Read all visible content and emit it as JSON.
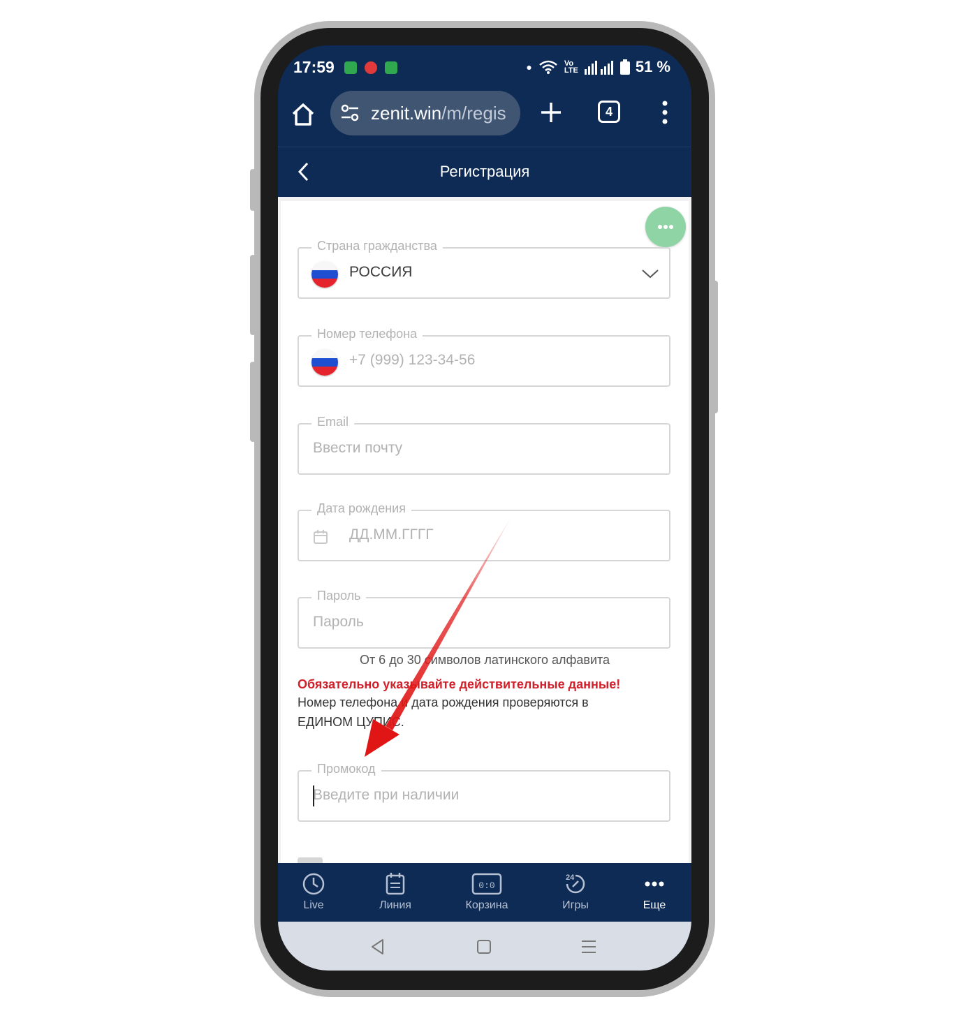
{
  "status_bar": {
    "time": "17:59",
    "battery": "51 %"
  },
  "browser": {
    "url_main": "zenit.win",
    "url_path": "/m/regis",
    "tab_count": "4"
  },
  "header": {
    "title": "Регистрация"
  },
  "form": {
    "citizenship": {
      "label": "Страна гражданства",
      "value": "РОССИЯ"
    },
    "phone": {
      "label": "Номер телефона",
      "placeholder": "+7 (999) 123-34-56"
    },
    "email": {
      "label": "Email",
      "placeholder": "Ввести почту"
    },
    "birthdate": {
      "label": "Дата рождения",
      "placeholder": "ДД.ММ.ГГГГ"
    },
    "password": {
      "label": "Пароль",
      "placeholder": "Пароль",
      "hint": "От 6 до 30 символов латинского алфавита"
    },
    "warning": "Обязательно указывайте действительные данные!",
    "info_line1": "Номер телефона и дата рождения проверяются в",
    "info_line2": "ЕДИНОМ ЦУПИС.",
    "promo": {
      "label": "Промокод",
      "placeholder": "Введите при наличии"
    }
  },
  "tab_bar": {
    "items": [
      {
        "label": "Live",
        "icon": "clock-icon"
      },
      {
        "label": "Линия",
        "icon": "calendar-icon"
      },
      {
        "label": "Корзина",
        "icon": "scoreboard-icon",
        "badge": "0:0"
      },
      {
        "label": "Игры",
        "icon": "games-24-icon",
        "badge": "24"
      },
      {
        "label": "Еще",
        "icon": "more-icon",
        "active": true
      }
    ]
  },
  "colors": {
    "header_bg": "#0d2b55",
    "accent_red": "#d0202a",
    "chat_green": "#8fd4a5",
    "arrow_red": "#e01515"
  }
}
